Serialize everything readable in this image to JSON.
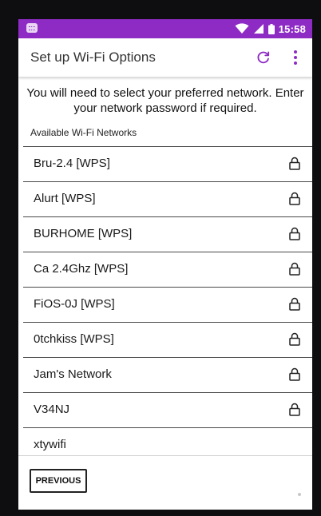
{
  "status_bar": {
    "time": "15:58",
    "accent_color": "#8e2bc4",
    "icons": [
      "notification-icon",
      "wifi-icon",
      "signal-icon",
      "battery-icon"
    ]
  },
  "app_bar": {
    "title": "Set up Wi-Fi Options",
    "actions": [
      "refresh-icon",
      "more-vert-icon"
    ]
  },
  "instructions": "You will need to select your preferred network. Enter your network password if required.",
  "section_title": "Available Wi-Fi Networks",
  "networks": [
    {
      "name": "Bru-2.4 [WPS]",
      "secured": true
    },
    {
      "name": "Alurt [WPS]",
      "secured": true
    },
    {
      "name": "BURHOME [WPS]",
      "secured": true
    },
    {
      "name": "Ca 2.4Ghz [WPS]",
      "secured": true
    },
    {
      "name": "FiOS-0J [WPS]",
      "secured": true
    },
    {
      "name": "0tchkiss [WPS]",
      "secured": true
    },
    {
      "name": "Jam's Network",
      "secured": true
    },
    {
      "name": "V34NJ",
      "secured": true
    },
    {
      "name": "xtywifi",
      "secured": false
    }
  ],
  "buttons": {
    "previous_label": "PREVIOUS"
  }
}
